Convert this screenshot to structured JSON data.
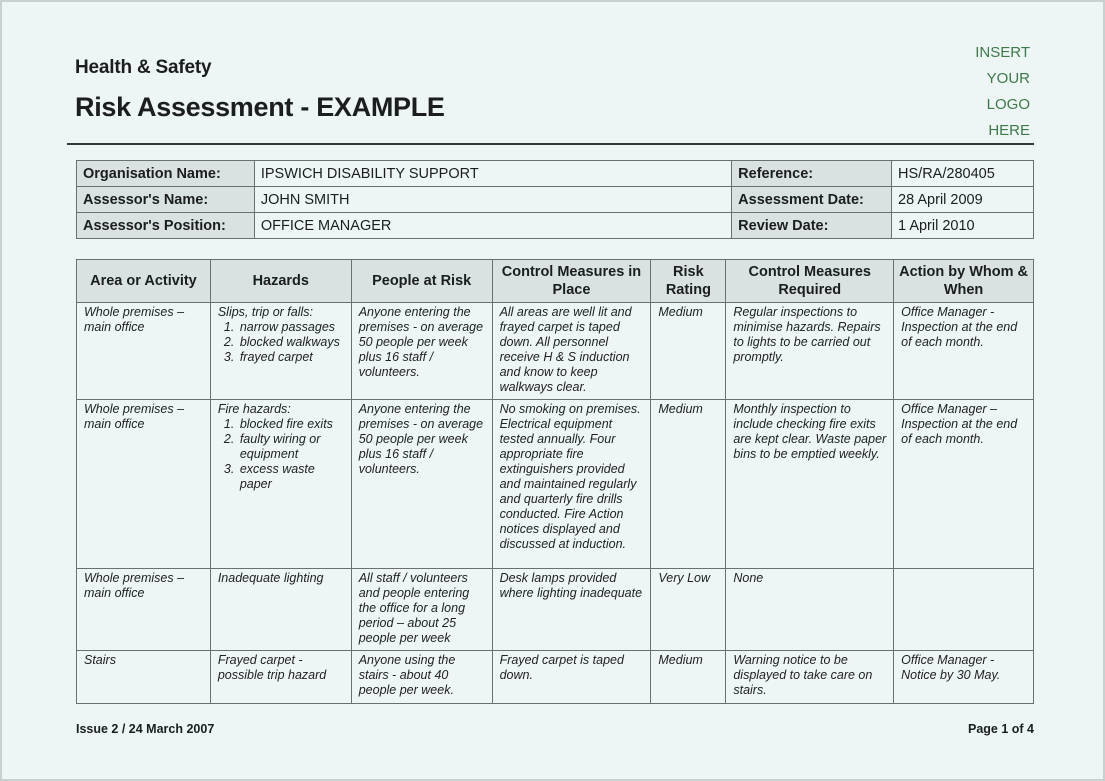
{
  "header": {
    "subtitle": "Health & Safety",
    "title": "Risk Assessment - EXAMPLE",
    "logo_lines": [
      "INSERT",
      "YOUR",
      "LOGO",
      "HERE"
    ]
  },
  "info": {
    "organisation_label": "Organisation Name:",
    "organisation_value": "IPSWICH DISABILITY SUPPORT",
    "assessor_name_label": "Assessor's Name:",
    "assessor_name_value": "JOHN SMITH",
    "assessor_position_label": "Assessor's Position:",
    "assessor_position_value": "OFFICE MANAGER",
    "reference_label": "Reference:",
    "reference_value": "HS/RA/280405",
    "assessment_date_label": "Assessment Date:",
    "assessment_date_value": "28 April 2009",
    "review_date_label": "Review Date:",
    "review_date_value": "1 April 2010"
  },
  "table": {
    "columns": [
      "Area or Activity",
      "Hazards",
      "People at Risk",
      "Control Measures in Place",
      "Risk Rating",
      "Control Measures Required",
      "Action by Whom & When"
    ],
    "rows": [
      {
        "area": "Whole premises – main office",
        "hazard_title": "Slips, trip or falls:",
        "hazard_items": [
          "narrow passages",
          "blocked walkways",
          "frayed carpet"
        ],
        "people": "Anyone entering the premises - on average 50 people per week plus 16 staff / volunteers.",
        "controls_in_place": "All areas are well lit and frayed carpet is taped down. All personnel receive H & S induction and know to keep walkways clear.",
        "risk_rating": "Medium",
        "controls_required": "Regular inspections to minimise hazards. Repairs to lights to be carried out promptly.",
        "action": "Office Manager - Inspection at the end of each month."
      },
      {
        "area": "Whole premises – main office",
        "hazard_title": "Fire hazards:",
        "hazard_items": [
          "blocked fire exits",
          "faulty wiring or equipment",
          "excess waste paper"
        ],
        "people": "Anyone entering the premises - on average 50 people per week plus 16 staff / volunteers.",
        "controls_in_place": "No smoking on premises. Electrical equipment tested annually. Four appropriate fire extinguishers provided and maintained regularly and quarterly fire drills conducted. Fire Action notices displayed and discussed at induction.",
        "risk_rating": "Medium",
        "controls_required": "Monthly inspection to include checking fire exits are kept clear. Waste paper bins to be emptied weekly.",
        "action": "Office Manager – Inspection at the end of each month."
      },
      {
        "area": "Whole premises – main office",
        "hazard_title": "Inadequate lighting",
        "hazard_items": [],
        "people": "All staff / volunteers and people entering the office for a long period – about 25 people per week",
        "controls_in_place": "Desk lamps provided where lighting inadequate",
        "risk_rating": "Very Low",
        "controls_required": "None",
        "action": ""
      },
      {
        "area": "Stairs",
        "hazard_title": "Frayed carpet - possible trip hazard",
        "hazard_items": [],
        "people": "Anyone using the stairs - about 40 people per week.",
        "controls_in_place": "Frayed carpet is taped down.",
        "risk_rating": "Medium",
        "controls_required": "Warning notice to be displayed to take care on stairs.",
        "action": "Office Manager - Notice by 30 May."
      }
    ]
  },
  "footer": {
    "issue": "Issue 2 / 24 March 2007",
    "page": "Page 1 of 4"
  }
}
